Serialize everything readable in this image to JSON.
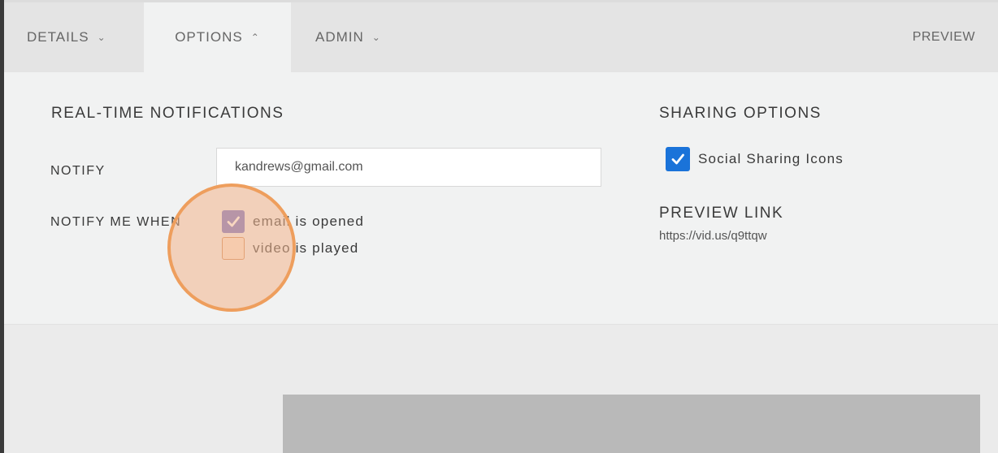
{
  "tabs": {
    "details": {
      "label": "DETAILS",
      "chevron": "chevron-down-icon"
    },
    "options": {
      "label": "OPTIONS",
      "chevron": "chevron-up-icon"
    },
    "admin": {
      "label": "ADMIN",
      "chevron": "chevron-down-icon"
    },
    "preview": {
      "label": "PREVIEW"
    }
  },
  "notifications": {
    "title": "REAL-TIME NOTIFICATIONS",
    "notify_label": "NOTIFY",
    "notify_value": "kandrews@gmail.com",
    "when_label": "NOTIFY ME WHEN",
    "options": [
      {
        "label": "email is opened",
        "checked": true
      },
      {
        "label": "video is played",
        "checked": false
      }
    ]
  },
  "sharing": {
    "title": "SHARING OPTIONS",
    "social_label": "Social Sharing Icons",
    "social_checked": true,
    "preview_link_title": "PREVIEW LINK",
    "preview_link_url": "https://vid.us/q9ttqw"
  },
  "colors": {
    "highlight": "#ee9e5d",
    "checkbox_purple": "#6f6fc8",
    "checkbox_blue": "#1a73d9"
  }
}
